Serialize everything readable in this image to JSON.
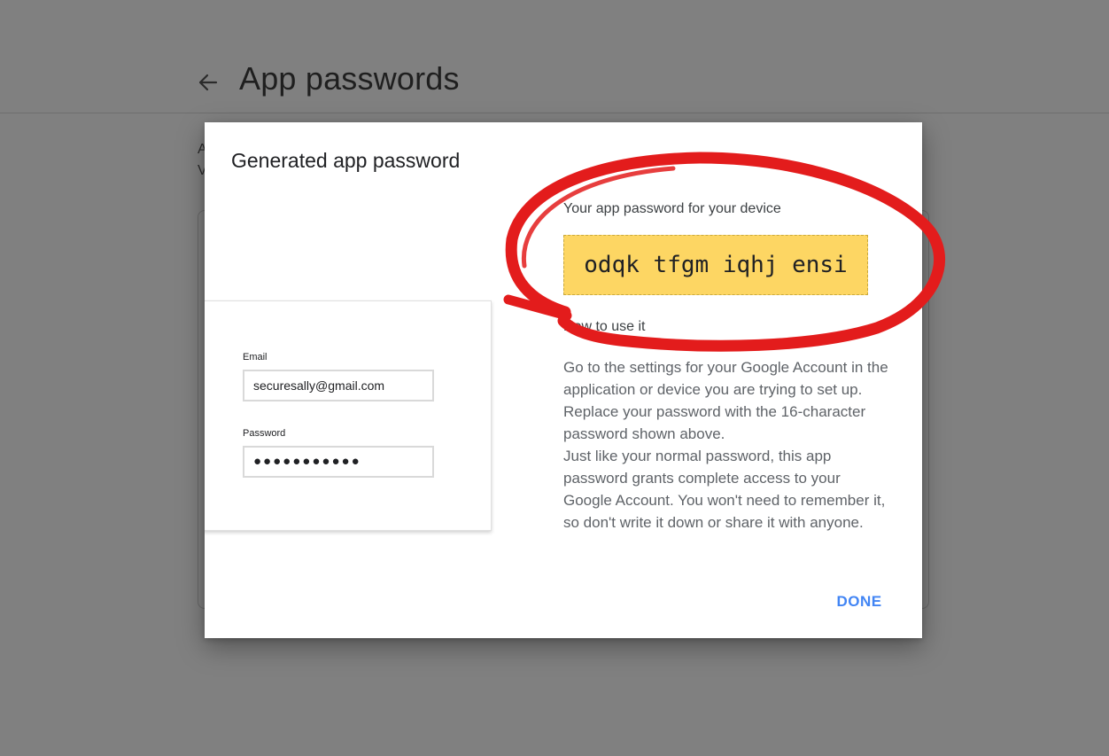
{
  "page": {
    "title": "App passwords",
    "bg_line_1": "A",
    "bg_line_2": "V"
  },
  "dialog": {
    "title": "Generated app password",
    "mock_form": {
      "email_label": "Email",
      "email_value": "securesally@gmail.com",
      "password_label": "Password",
      "password_value": "●●●●●●●●●●●"
    },
    "password_heading": "Your app password for your device",
    "app_password": "odqk tfgm iqhj ensi",
    "howto_heading": "How to use it",
    "instructions_p1": "Go to the settings for your Google Account in the application or device you are trying to set up. Replace your password with the 16-character password shown above.",
    "instructions_p2": "Just like your normal password, this app password grants complete access to your Google Account. You won't need to remember it, so don't write it down or share it with anyone.",
    "done_label": "DONE"
  },
  "icons": {
    "back": "arrow-back-icon"
  },
  "colors": {
    "overlay": "#808080",
    "password_highlight": "#fdd663",
    "done_button": "#4285f4",
    "annotation_circle": "#e31c1c"
  }
}
